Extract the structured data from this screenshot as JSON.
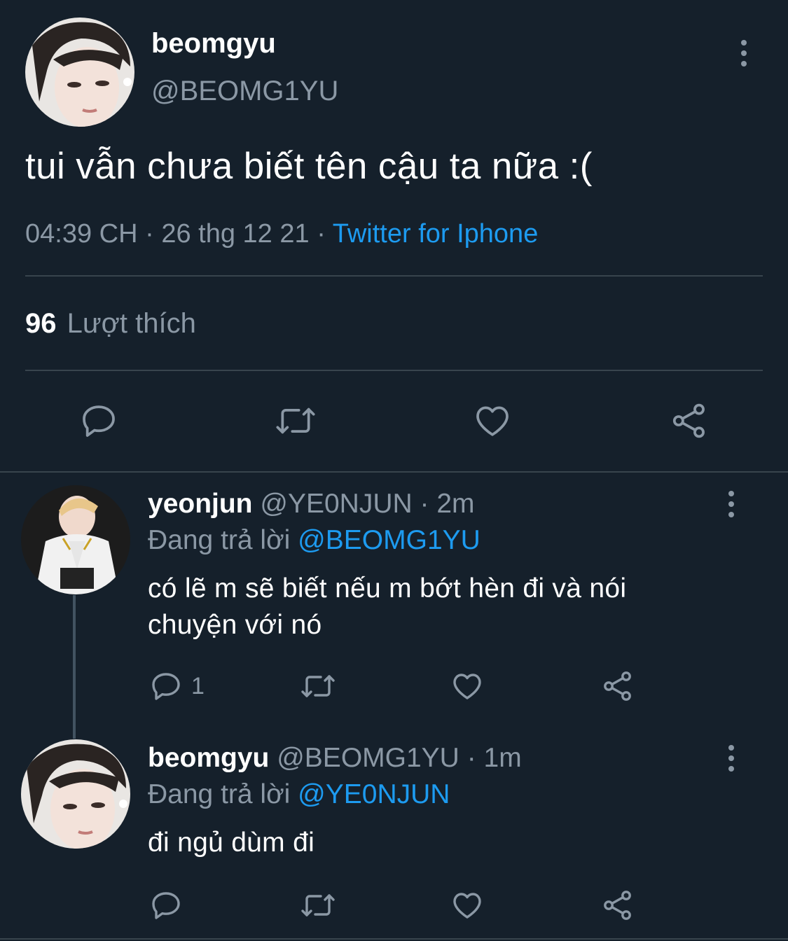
{
  "main_tweet": {
    "display_name": "beomgyu",
    "handle": "@BEOMG1YU",
    "text": "tui vẫn chưa biết tên cậu ta nữa :(",
    "time": "04:39 CH",
    "date": "26 thg 12 21",
    "source": "Twitter for Iphone",
    "likes_count": "96",
    "likes_label": "Lượt thích"
  },
  "replies": [
    {
      "display_name": "yeonjun",
      "handle": "@YE0NJUN",
      "age": "2m",
      "replying_label": "Đang trả lời",
      "replying_to": "@BEOMG1YU",
      "text": "có lẽ m sẽ biết nếu m bớt hèn đi và nói chuyện với nó",
      "reply_count": "1"
    },
    {
      "display_name": "beomgyu",
      "handle": "@BEOMG1YU",
      "age": "1m",
      "replying_label": "Đang trả lời",
      "replying_to": "@YE0NJUN",
      "text": "đi ngủ dùm đi",
      "reply_count": ""
    }
  ],
  "separator": "·",
  "icons": [
    "comment-icon",
    "retweet-icon",
    "like-icon",
    "share-icon",
    "more-icon"
  ],
  "colors": {
    "background": "#15202b",
    "text": "#ffffff",
    "muted": "#8b98a5",
    "accent": "#1d9bf0",
    "divider": "#38444d"
  }
}
